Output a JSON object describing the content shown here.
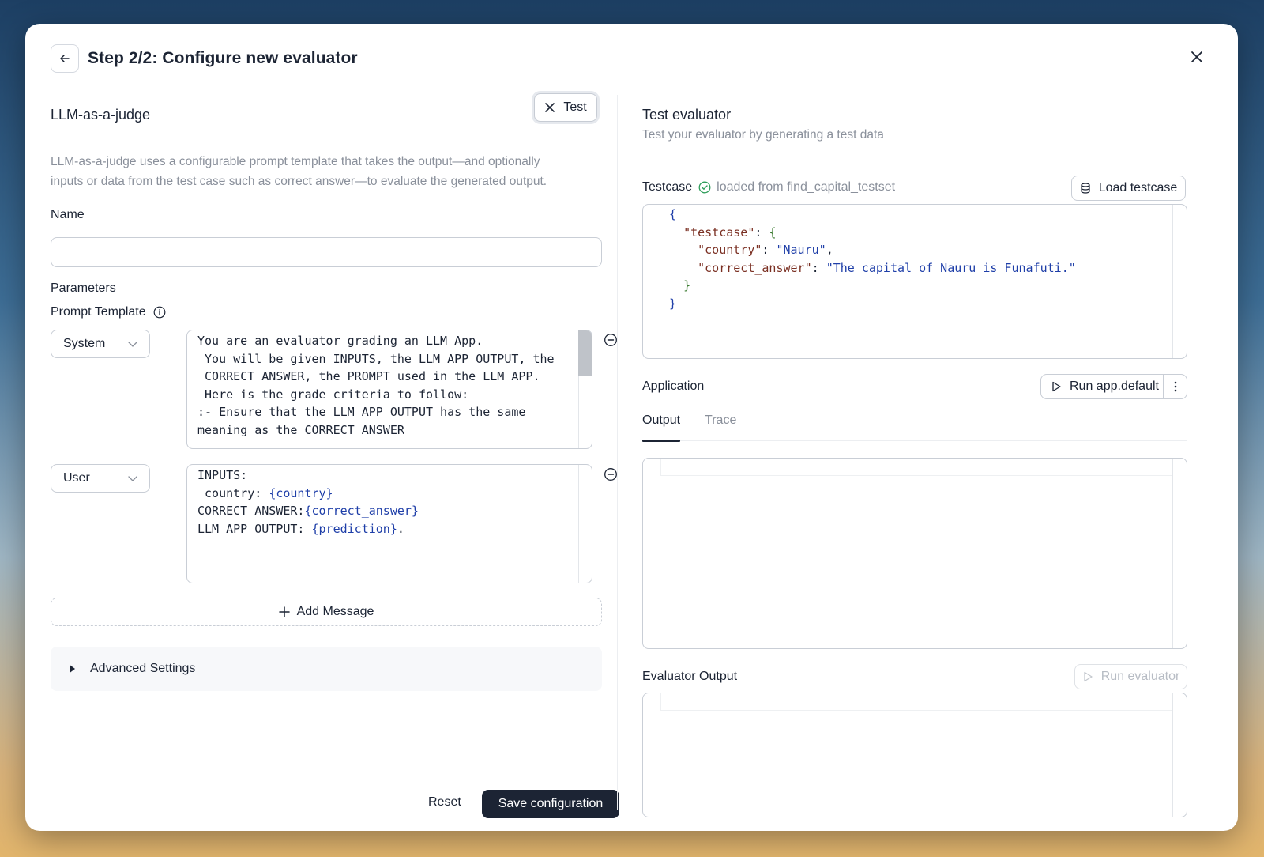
{
  "header": {
    "title": "Step 2/2:  Configure new evaluator"
  },
  "left": {
    "evaluator_name": "LLM-as-a-judge",
    "test_button": "Test",
    "description_line1": "LLM-as-a-judge uses a configurable prompt template that takes the output—and optionally",
    "description_line2": "inputs or data from the test case such as correct answer—to evaluate the generated output.",
    "name_label": "Name",
    "name_value": "",
    "parameters_label": "Parameters",
    "prompt_template_label": "Prompt Template",
    "messages": [
      {
        "role": "System",
        "content_lines": [
          "You are an evaluator grading an LLM App.",
          " You will be given INPUTS, the LLM APP OUTPUT, the",
          " CORRECT ANSWER, the PROMPT used in the LLM APP.",
          " Here is the grade criteria to follow:",
          ":- Ensure that the LLM APP OUTPUT has the same",
          "meaning as the CORRECT ANSWER"
        ]
      },
      {
        "role": "User",
        "content_lines": [
          [
            "INPUTS:",
            ""
          ],
          [
            " country: ",
            "{country}"
          ],
          [
            "CORRECT ANSWER:",
            "{correct_answer}"
          ],
          [
            "LLM APP OUTPUT: ",
            "{prediction}",
            "."
          ]
        ]
      }
    ],
    "add_message_label": "Add Message",
    "advanced_settings_label": "Advanced Settings",
    "reset_label": "Reset",
    "save_label": "Save configuration"
  },
  "right": {
    "title": "Test evaluator",
    "subtitle": "Test your evaluator by generating a test data",
    "testcase_label": "Testcase",
    "testcase_source": "loaded from find_capital_testset",
    "load_testcase_label": "Load testcase",
    "testcase_json": {
      "root_key": "\"testcase\"",
      "country_key": "\"country\"",
      "country_value": "\"Nauru\"",
      "answer_key": "\"correct_answer\"",
      "answer_value": "\"The capital of Nauru is Funafuti.\""
    },
    "application_label": "Application",
    "run_app_label": "Run app.default",
    "tabs": [
      "Output",
      "Trace"
    ],
    "active_tab": "Output",
    "evaluator_output_label": "Evaluator Output",
    "run_evaluator_label": "Run evaluator"
  },
  "icons": {
    "back": "arrow-left-icon",
    "close": "close-icon",
    "test_x": "x-icon",
    "info": "info-icon",
    "chevron": "chevron-down-icon",
    "remove": "minus-circle-icon",
    "plus": "plus-icon",
    "caret": "caret-right-icon",
    "check": "check-circle-icon",
    "database": "database-icon",
    "play": "play-icon",
    "more": "more-vertical-icon"
  },
  "colors": {
    "primary": "#1c2434",
    "muted": "#8a909b",
    "success": "#2f9e5b",
    "code_string": "#1e3ea8",
    "code_key": "#7a2f22"
  }
}
